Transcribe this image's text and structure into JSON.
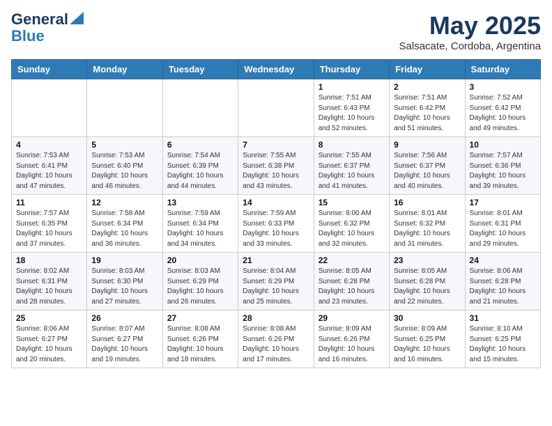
{
  "header": {
    "logo_line1": "General",
    "logo_line2": "Blue",
    "main_title": "May 2025",
    "subtitle": "Salsacate, Cordoba, Argentina"
  },
  "days_of_week": [
    "Sunday",
    "Monday",
    "Tuesday",
    "Wednesday",
    "Thursday",
    "Friday",
    "Saturday"
  ],
  "weeks": [
    [
      {
        "day": "",
        "info": ""
      },
      {
        "day": "",
        "info": ""
      },
      {
        "day": "",
        "info": ""
      },
      {
        "day": "",
        "info": ""
      },
      {
        "day": "1",
        "info": "Sunrise: 7:51 AM\nSunset: 6:43 PM\nDaylight: 10 hours\nand 52 minutes."
      },
      {
        "day": "2",
        "info": "Sunrise: 7:51 AM\nSunset: 6:42 PM\nDaylight: 10 hours\nand 51 minutes."
      },
      {
        "day": "3",
        "info": "Sunrise: 7:52 AM\nSunset: 6:42 PM\nDaylight: 10 hours\nand 49 minutes."
      }
    ],
    [
      {
        "day": "4",
        "info": "Sunrise: 7:53 AM\nSunset: 6:41 PM\nDaylight: 10 hours\nand 47 minutes."
      },
      {
        "day": "5",
        "info": "Sunrise: 7:53 AM\nSunset: 6:40 PM\nDaylight: 10 hours\nand 46 minutes."
      },
      {
        "day": "6",
        "info": "Sunrise: 7:54 AM\nSunset: 6:39 PM\nDaylight: 10 hours\nand 44 minutes."
      },
      {
        "day": "7",
        "info": "Sunrise: 7:55 AM\nSunset: 6:38 PM\nDaylight: 10 hours\nand 43 minutes."
      },
      {
        "day": "8",
        "info": "Sunrise: 7:55 AM\nSunset: 6:37 PM\nDaylight: 10 hours\nand 41 minutes."
      },
      {
        "day": "9",
        "info": "Sunrise: 7:56 AM\nSunset: 6:37 PM\nDaylight: 10 hours\nand 40 minutes."
      },
      {
        "day": "10",
        "info": "Sunrise: 7:57 AM\nSunset: 6:36 PM\nDaylight: 10 hours\nand 39 minutes."
      }
    ],
    [
      {
        "day": "11",
        "info": "Sunrise: 7:57 AM\nSunset: 6:35 PM\nDaylight: 10 hours\nand 37 minutes."
      },
      {
        "day": "12",
        "info": "Sunrise: 7:58 AM\nSunset: 6:34 PM\nDaylight: 10 hours\nand 36 minutes."
      },
      {
        "day": "13",
        "info": "Sunrise: 7:59 AM\nSunset: 6:34 PM\nDaylight: 10 hours\nand 34 minutes."
      },
      {
        "day": "14",
        "info": "Sunrise: 7:59 AM\nSunset: 6:33 PM\nDaylight: 10 hours\nand 33 minutes."
      },
      {
        "day": "15",
        "info": "Sunrise: 8:00 AM\nSunset: 6:32 PM\nDaylight: 10 hours\nand 32 minutes."
      },
      {
        "day": "16",
        "info": "Sunrise: 8:01 AM\nSunset: 6:32 PM\nDaylight: 10 hours\nand 31 minutes."
      },
      {
        "day": "17",
        "info": "Sunrise: 8:01 AM\nSunset: 6:31 PM\nDaylight: 10 hours\nand 29 minutes."
      }
    ],
    [
      {
        "day": "18",
        "info": "Sunrise: 8:02 AM\nSunset: 6:31 PM\nDaylight: 10 hours\nand 28 minutes."
      },
      {
        "day": "19",
        "info": "Sunrise: 8:03 AM\nSunset: 6:30 PM\nDaylight: 10 hours\nand 27 minutes."
      },
      {
        "day": "20",
        "info": "Sunrise: 8:03 AM\nSunset: 6:29 PM\nDaylight: 10 hours\nand 26 minutes."
      },
      {
        "day": "21",
        "info": "Sunrise: 8:04 AM\nSunset: 6:29 PM\nDaylight: 10 hours\nand 25 minutes."
      },
      {
        "day": "22",
        "info": "Sunrise: 8:05 AM\nSunset: 6:28 PM\nDaylight: 10 hours\nand 23 minutes."
      },
      {
        "day": "23",
        "info": "Sunrise: 8:05 AM\nSunset: 6:28 PM\nDaylight: 10 hours\nand 22 minutes."
      },
      {
        "day": "24",
        "info": "Sunrise: 8:06 AM\nSunset: 6:28 PM\nDaylight: 10 hours\nand 21 minutes."
      }
    ],
    [
      {
        "day": "25",
        "info": "Sunrise: 8:06 AM\nSunset: 6:27 PM\nDaylight: 10 hours\nand 20 minutes."
      },
      {
        "day": "26",
        "info": "Sunrise: 8:07 AM\nSunset: 6:27 PM\nDaylight: 10 hours\nand 19 minutes."
      },
      {
        "day": "27",
        "info": "Sunrise: 8:08 AM\nSunset: 6:26 PM\nDaylight: 10 hours\nand 18 minutes."
      },
      {
        "day": "28",
        "info": "Sunrise: 8:08 AM\nSunset: 6:26 PM\nDaylight: 10 hours\nand 17 minutes."
      },
      {
        "day": "29",
        "info": "Sunrise: 8:09 AM\nSunset: 6:26 PM\nDaylight: 10 hours\nand 16 minutes."
      },
      {
        "day": "30",
        "info": "Sunrise: 8:09 AM\nSunset: 6:25 PM\nDaylight: 10 hours\nand 16 minutes."
      },
      {
        "day": "31",
        "info": "Sunrise: 8:10 AM\nSunset: 6:25 PM\nDaylight: 10 hours\nand 15 minutes."
      }
    ]
  ]
}
